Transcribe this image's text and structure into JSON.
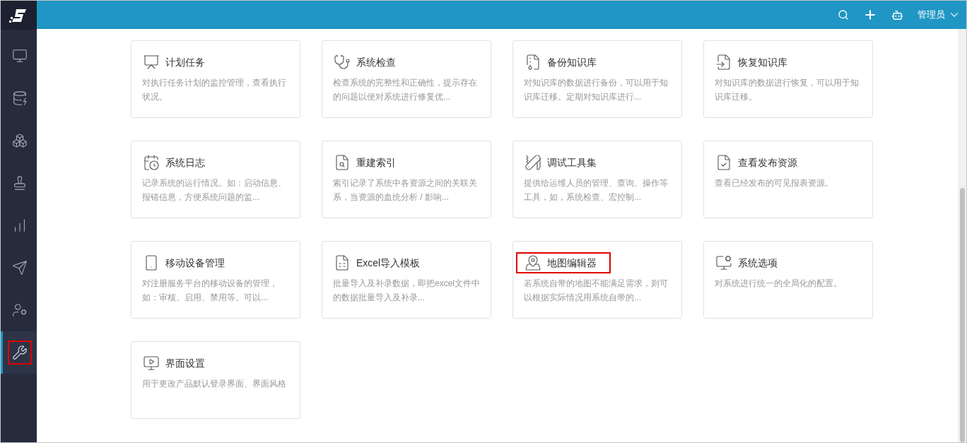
{
  "sidebar": {
    "items": [
      {
        "selected": false,
        "highlighted": false
      },
      {
        "selected": false,
        "highlighted": false
      },
      {
        "selected": false,
        "highlighted": false
      },
      {
        "selected": false,
        "highlighted": false
      },
      {
        "selected": false,
        "highlighted": false
      },
      {
        "selected": false,
        "highlighted": false
      },
      {
        "selected": false,
        "highlighted": false
      },
      {
        "selected": true,
        "highlighted": true
      }
    ]
  },
  "header": {
    "user": "管理员"
  },
  "cards": [
    {
      "title": "计划任务",
      "description": "对执行任务计划的监控管理，查看执行状况。",
      "highlighted": false
    },
    {
      "title": "系统检查",
      "description": "检查系统的完整性和正确性，提示存在的问题以便对系统进行修复优...",
      "highlighted": false
    },
    {
      "title": "备份知识库",
      "description": "对知识库的数据进行备份，可以用于知识库迁移。定期对知识库进行...",
      "highlighted": false
    },
    {
      "title": "恢复知识库",
      "description": "对知识库的数据进行恢复，可以用于知识库迁移。",
      "highlighted": false
    },
    {
      "title": "系统日志",
      "description": "记录系统的运行情况。如：启动信息、报错信息，方便系统问题的监...",
      "highlighted": false
    },
    {
      "title": "重建索引",
      "description": "索引记录了系统中各资源之间的关联关系，当资源的血统分析 / 影响...",
      "highlighted": false
    },
    {
      "title": "调试工具集",
      "description": "提供给运维人员的管理、查询、操作等工具，如，系统检查、宏控制...",
      "highlighted": false
    },
    {
      "title": "查看发布资源",
      "description": "查看已经发布的可见报表资源。",
      "highlighted": false
    },
    {
      "title": "移动设备管理",
      "description": "对注册服务平台的移动设备的管理，如：审核、启用、禁用等。可以...",
      "highlighted": false
    },
    {
      "title": "Excel导入模板",
      "description": "批量导入及补录数据，即把excel文件中的数据批量导入及补录...",
      "highlighted": false
    },
    {
      "title": "地图编辑器",
      "description": "若系统自带的地图不能满足需求，则可以根据实际情况用系统自带的...",
      "highlighted": true
    },
    {
      "title": "系统选项",
      "description": "对系统进行统一的全局化的配置。",
      "highlighted": false
    },
    {
      "title": "界面设置",
      "description": "用于更改产品默认登录界面、界面风格",
      "highlighted": false
    }
  ]
}
